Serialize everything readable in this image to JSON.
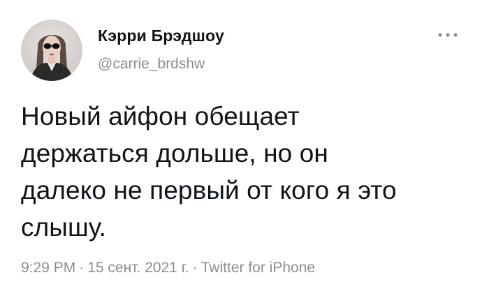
{
  "author": {
    "display_name": "Кэрри Брэдшоу",
    "handle": "@carrie_brdshw"
  },
  "tweet": {
    "lines": [
      "Новый айфон обещает",
      "держаться дольше, но он",
      "далеко не первый от кого я это",
      "слышу."
    ]
  },
  "meta": {
    "time": "9:29 PM",
    "separator_1": "·",
    "date": "15 сент. 2021 г.",
    "separator_2": "·",
    "source": "Twitter for iPhone"
  },
  "icons": {
    "more": "more-horizontal-icon",
    "avatar": "profile-photo"
  },
  "colors": {
    "text_primary": "#0f1419",
    "text_secondary": "#8a8f94",
    "background": "#ffffff"
  }
}
